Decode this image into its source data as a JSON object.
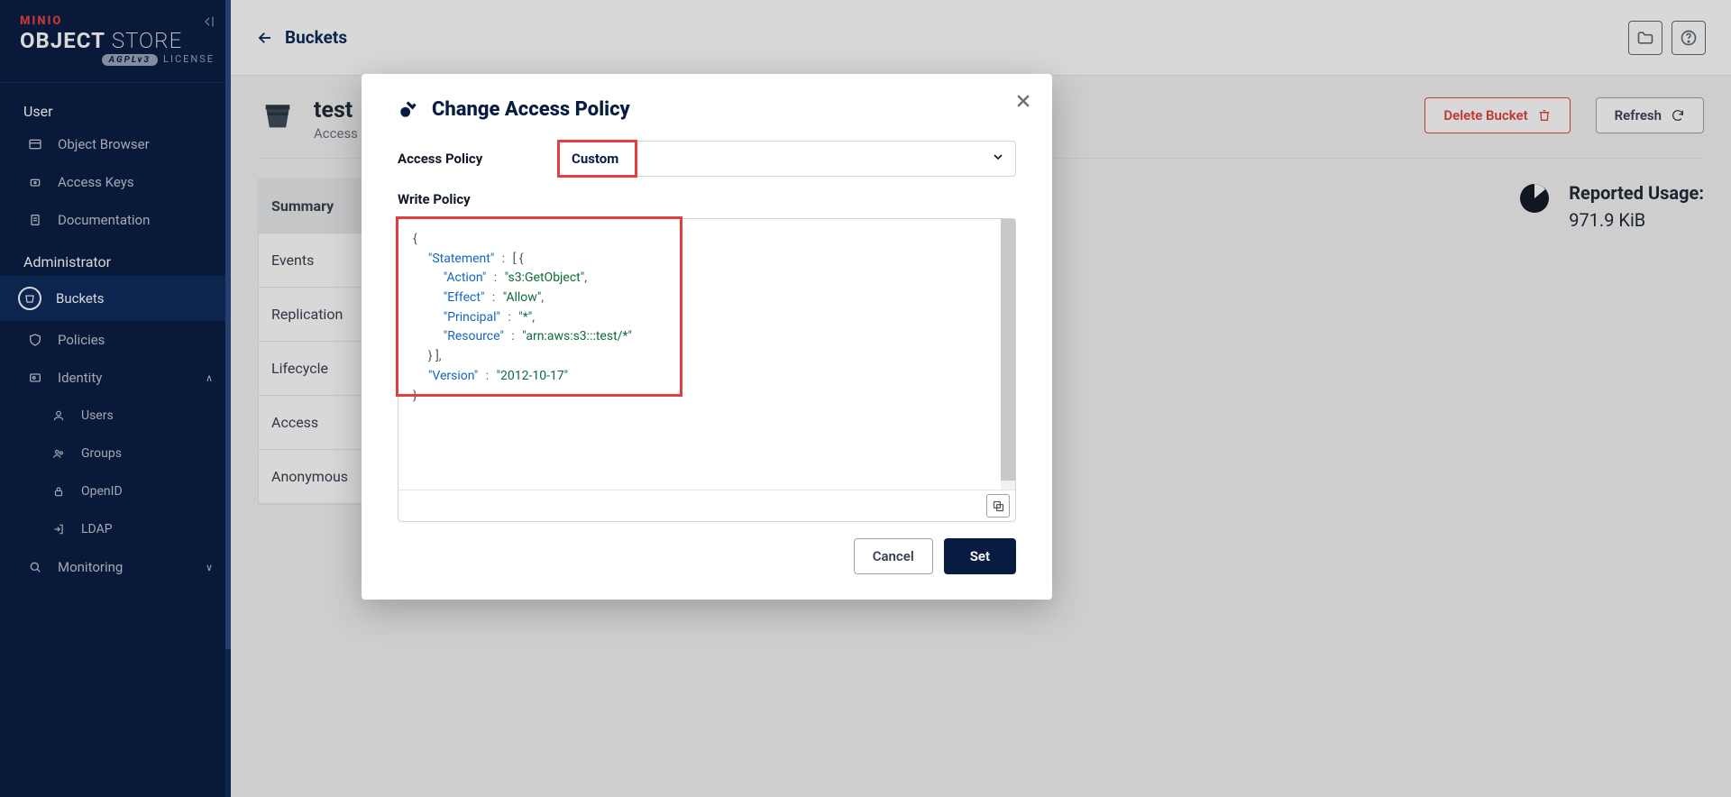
{
  "brand": {
    "line1": "MINIO",
    "line2a": "OBJECT",
    "line2b": "STORE",
    "license_badge": "AGPLv3",
    "license_text": "LICENSE"
  },
  "sidebar": {
    "section_user": "User",
    "user_items": [
      "Object Browser",
      "Access Keys",
      "Documentation"
    ],
    "section_admin": "Administrator",
    "admin_items": {
      "buckets": "Buckets",
      "policies": "Policies",
      "identity": "Identity",
      "identity_sub": [
        "Users",
        "Groups",
        "OpenID",
        "LDAP"
      ],
      "monitoring": "Monitoring"
    }
  },
  "topbar": {
    "title": "Buckets"
  },
  "bucket": {
    "name": "test",
    "access_label_prefix": "Access",
    "delete_label": "Delete Bucket",
    "refresh_label": "Refresh"
  },
  "tabs": [
    "Summary",
    "Events",
    "Replication",
    "Lifecycle",
    "Access",
    "Anonymous"
  ],
  "usage": {
    "title": "Reported Usage:",
    "value": "971.9 KiB"
  },
  "modal": {
    "title": "Change Access Policy",
    "field_label": "Access Policy",
    "select_value": "Custom",
    "policy_label": "Write Policy",
    "cancel": "Cancel",
    "set": "Set",
    "policy_json": {
      "Statement": [
        {
          "Action": "s3:GetObject",
          "Effect": "Allow",
          "Principal": "*",
          "Resource": "arn:aws:s3:::test/*"
        }
      ],
      "Version": "2012-10-17"
    }
  }
}
